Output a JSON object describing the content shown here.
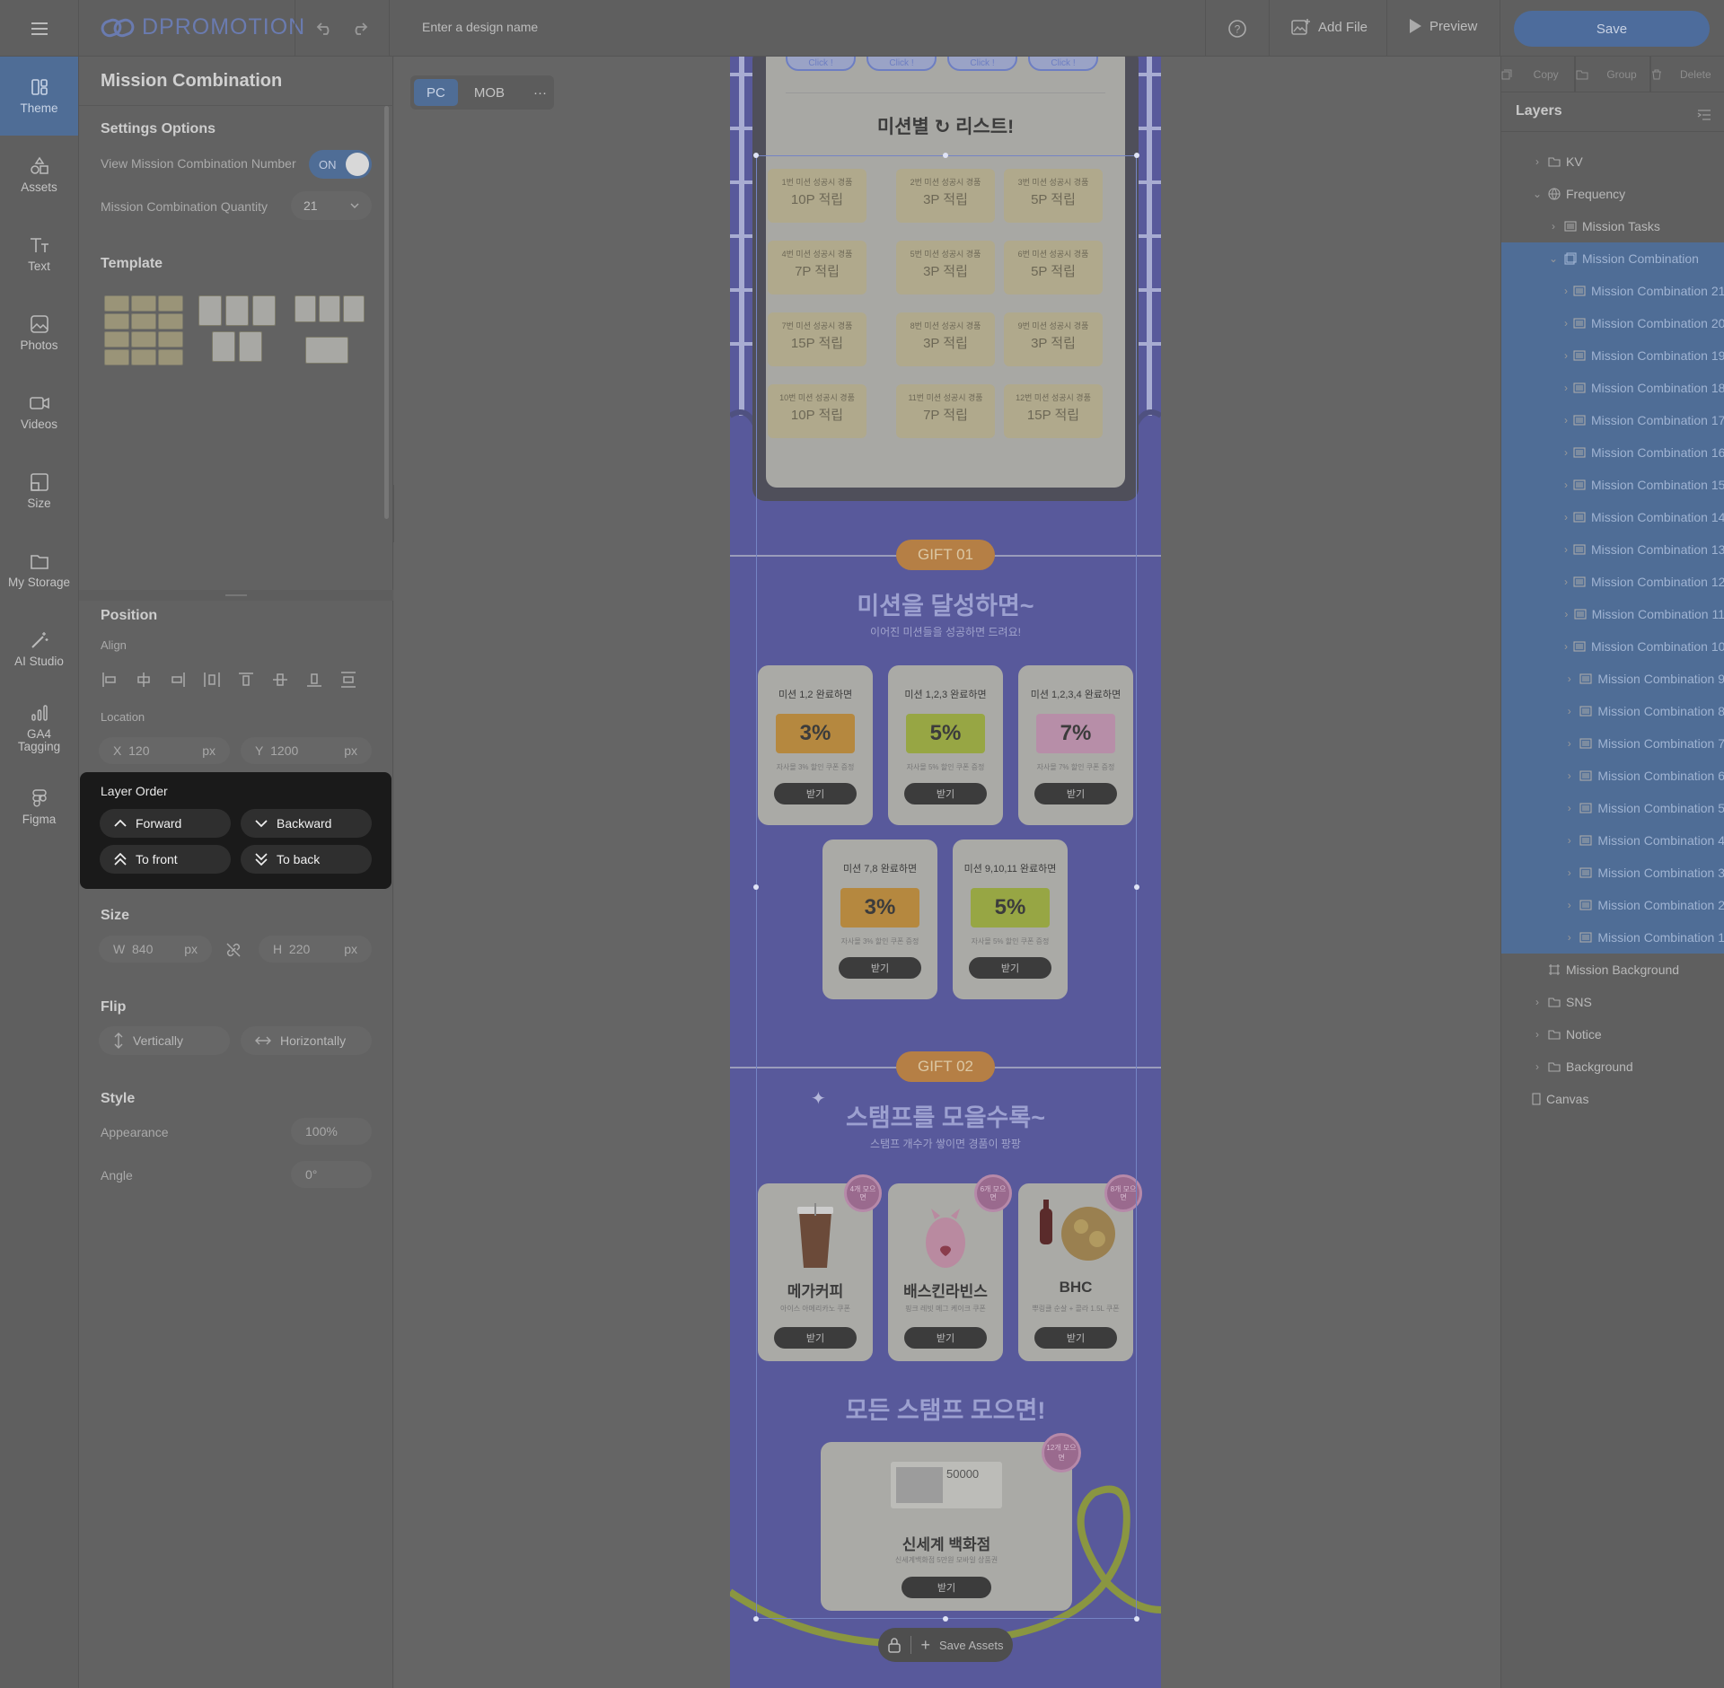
{
  "topbar": {
    "logo": "DPROMOTION",
    "design_name_placeholder": "Enter a design name",
    "add_file": "Add File",
    "preview": "Preview",
    "save": "Save"
  },
  "rail": [
    {
      "label": "Theme",
      "icon": "theme-icon"
    },
    {
      "label": "Assets",
      "icon": "assets-icon"
    },
    {
      "label": "Text",
      "icon": "text-icon"
    },
    {
      "label": "Photos",
      "icon": "photos-icon"
    },
    {
      "label": "Videos",
      "icon": "videos-icon"
    },
    {
      "label": "Size",
      "icon": "size-icon"
    },
    {
      "label": "My Storage",
      "icon": "folder-icon"
    },
    {
      "label": "AI Studio",
      "icon": "magic-wand-icon"
    },
    {
      "label": "GA4 Tagging",
      "icon": "analytics-icon"
    },
    {
      "label": "Figma",
      "icon": "figma-icon"
    }
  ],
  "panel": {
    "title": "Mission Combination",
    "settings_options": "Settings Options",
    "view_number_label": "View Mission Combination Number",
    "toggle": "ON",
    "quantity_label": "Mission Combination Quantity",
    "quantity_value": "21",
    "template": "Template",
    "position": "Position",
    "align": "Align",
    "location": "Location",
    "x_label": "X",
    "x_value": "120",
    "y_label": "Y",
    "y_value": "1200",
    "unit": "px",
    "layer_order": "Layer Order",
    "forward": "Forward",
    "backward": "Backward",
    "to_front": "To front",
    "to_back": "To back",
    "size": "Size",
    "w_label": "W",
    "w_value": "840",
    "h_label": "H",
    "h_value": "220",
    "flip": "Flip",
    "vertically": "Vertically",
    "horizontally": "Horizontally",
    "style": "Style",
    "appearance": "Appearance",
    "appearance_value": "100%",
    "angle": "Angle",
    "angle_value": "0°"
  },
  "canvas": {
    "tab_pc": "PC",
    "tab_mob": "MOB",
    "more": "···",
    "click_label": "Click !",
    "mission_list_title": "미션별 ",
    "mission_list_title2": " 리스트!",
    "missions": [
      {
        "sub": "1번 미션 성공시 경품",
        "val": "10P 적립"
      },
      {
        "sub": "2번 미션 성공시 경품",
        "val": "3P 적립"
      },
      {
        "sub": "3번 미션 성공시 경품",
        "val": "5P 적립"
      },
      {
        "sub": "4번 미션 성공시 경품",
        "val": "7P 적립"
      },
      {
        "sub": "5번 미션 성공시 경품",
        "val": "3P 적립"
      },
      {
        "sub": "6번 미션 성공시 경품",
        "val": "5P 적립"
      },
      {
        "sub": "7번 미션 성공시 경품",
        "val": "15P 적립"
      },
      {
        "sub": "8번 미션 성공시 경품",
        "val": "3P 적립"
      },
      {
        "sub": "9번 미션 성공시 경품",
        "val": "3P 적립"
      },
      {
        "sub": "10번 미션 성공시 경품",
        "val": "10P 적립"
      },
      {
        "sub": "11번 미션 성공시 경품",
        "val": "7P 적립"
      },
      {
        "sub": "12번 미션 성공시 경품",
        "val": "15P 적립"
      }
    ],
    "gift1": "GIFT 01",
    "gift1_title": "미션을 달성하면~",
    "gift1_sub": "이어진 미션들을 성공하면 드려요!",
    "coupons": [
      {
        "title": "미션 1,2 완료하면",
        "value": "3%",
        "desc": "자사몰 3% 할인 쿠폰 증정",
        "color": "#b5883f"
      },
      {
        "title": "미션 1,2,3 완료하면",
        "value": "5%",
        "desc": "자사몰 5% 할인 쿠폰 증정",
        "color": "#97a644"
      },
      {
        "title": "미션 1,2,3,4 완료하면",
        "value": "7%",
        "desc": "자사몰 7% 할인 쿠폰 증정",
        "color": "#b78ea8"
      },
      {
        "title": "미션 7,8 완료하면",
        "value": "3%",
        "desc": "자사몰 3% 할인 쿠폰 증정",
        "color": "#b5883f"
      },
      {
        "title": "미션 9,10,11 완료하면",
        "value": "5%",
        "desc": "자사몰 5% 할인 쿠폰 증정",
        "color": "#97a644"
      }
    ],
    "receive": "받기",
    "gift2": "GIFT 02",
    "gift2_title": "스탬프를 모을수록~",
    "gift2_sub": "스탬프 개수가 쌓이면 경품이 팡팡",
    "stamps": [
      {
        "name": "메가커피",
        "desc": "아이스 아메리카노 쿠폰",
        "badge": "4개 모으면"
      },
      {
        "name": "배스킨라빈스",
        "desc": "핑크 레빗 메그 케이크 쿠폰",
        "badge": "6개 모으면"
      },
      {
        "name": "BHC",
        "desc": "뿌링클 순살 + 콜라 1.5L 쿠폰",
        "badge": "8개 모으면"
      }
    ],
    "all_stamp_title": "모든 스탬프 모으면!",
    "final": {
      "amount": "50000",
      "name": "신세계 백화점",
      "desc": "신세계백화점 5만원 모바일 상품권",
      "badge": "12개 모으면"
    },
    "save_assets": "Save Assets"
  },
  "right": {
    "copy": "Copy",
    "group": "Group",
    "delete": "Delete",
    "layers_title": "Layers",
    "layers": [
      {
        "label": "KV",
        "indent": 1,
        "type": "folder",
        "chev": "›"
      },
      {
        "label": "Frequency",
        "indent": 1,
        "type": "globe",
        "chev": "⌄"
      },
      {
        "label": "Mission Tasks",
        "indent": 2,
        "type": "list",
        "chev": "›"
      },
      {
        "label": "Mission Combination",
        "indent": 2,
        "type": "stack",
        "chev": "⌄",
        "selected": true
      },
      {
        "label": "Mission Combination 21",
        "indent": 3,
        "type": "list",
        "chev": "›",
        "selected": true
      },
      {
        "label": "Mission Combination 20",
        "indent": 3,
        "type": "list",
        "chev": "›",
        "selected": true
      },
      {
        "label": "Mission Combination 19",
        "indent": 3,
        "type": "list",
        "chev": "›",
        "selected": true
      },
      {
        "label": "Mission Combination 18",
        "indent": 3,
        "type": "list",
        "chev": "›",
        "selected": true
      },
      {
        "label": "Mission Combination 17",
        "indent": 3,
        "type": "list",
        "chev": "›",
        "selected": true
      },
      {
        "label": "Mission Combination 16",
        "indent": 3,
        "type": "list",
        "chev": "›",
        "selected": true
      },
      {
        "label": "Mission Combination 15",
        "indent": 3,
        "type": "list",
        "chev": "›",
        "selected": true
      },
      {
        "label": "Mission Combination 14",
        "indent": 3,
        "type": "list",
        "chev": "›",
        "selected": true
      },
      {
        "label": "Mission Combination 13",
        "indent": 3,
        "type": "list",
        "chev": "›",
        "selected": true
      },
      {
        "label": "Mission Combination 12",
        "indent": 3,
        "type": "list",
        "chev": "›",
        "selected": true
      },
      {
        "label": "Mission Combination 11",
        "indent": 3,
        "type": "list",
        "chev": "›",
        "selected": true
      },
      {
        "label": "Mission Combination 10",
        "indent": 3,
        "type": "list",
        "chev": "›",
        "selected": true
      },
      {
        "label": "Mission Combination 9",
        "indent": 3,
        "type": "list",
        "chev": "›",
        "selected": true
      },
      {
        "label": "Mission Combination 8",
        "indent": 3,
        "type": "list",
        "chev": "›",
        "selected": true
      },
      {
        "label": "Mission Combination 7",
        "indent": 3,
        "type": "list",
        "chev": "›",
        "selected": true
      },
      {
        "label": "Mission Combination 6",
        "indent": 3,
        "type": "list",
        "chev": "›",
        "selected": true
      },
      {
        "label": "Mission Combination 5",
        "indent": 3,
        "type": "list",
        "chev": "›",
        "selected": true
      },
      {
        "label": "Mission Combination 4",
        "indent": 3,
        "type": "list",
        "chev": "›",
        "selected": true
      },
      {
        "label": "Mission Combination 3",
        "indent": 3,
        "type": "list",
        "chev": "›",
        "selected": true
      },
      {
        "label": "Mission Combination 2",
        "indent": 3,
        "type": "list",
        "chev": "›",
        "selected": true
      },
      {
        "label": "Mission Combination 1",
        "indent": 3,
        "type": "list",
        "chev": "›",
        "selected": true
      },
      {
        "label": "Mission Background",
        "indent": 1,
        "type": "frame",
        "chev": ""
      },
      {
        "label": "SNS",
        "indent": 1,
        "type": "folder",
        "chev": "›"
      },
      {
        "label": "Notice",
        "indent": 1,
        "type": "folder",
        "chev": "›"
      },
      {
        "label": "Background",
        "indent": 1,
        "type": "folder",
        "chev": "›"
      },
      {
        "label": "Canvas",
        "indent": 0,
        "type": "page",
        "chev": ""
      }
    ]
  }
}
